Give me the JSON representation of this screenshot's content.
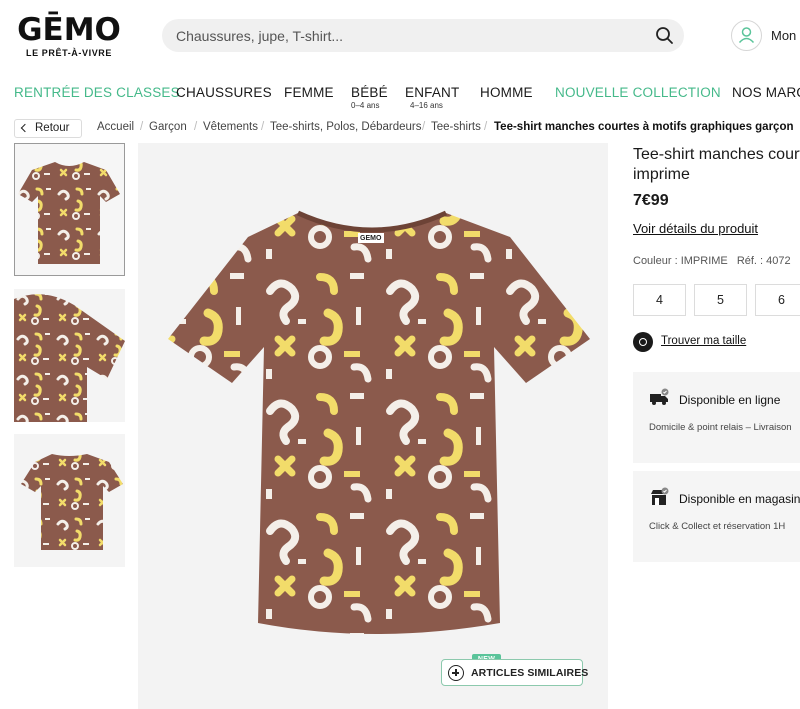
{
  "header": {
    "logo_word": "GĒMO",
    "logo_tagline": "LE PRÊT-À-VIVRE",
    "search_placeholder": "Chaussures, jupe, T-shirt...",
    "account_label": "Mon"
  },
  "nav": {
    "items": [
      {
        "label": "RENTRÉE DES CLASSES",
        "sub": ""
      },
      {
        "label": "CHAUSSURES",
        "sub": ""
      },
      {
        "label": "FEMME",
        "sub": ""
      },
      {
        "label": "BÉBÉ",
        "sub": "0–4 ans"
      },
      {
        "label": "ENFANT",
        "sub": "4–16 ans"
      },
      {
        "label": "HOMME",
        "sub": ""
      },
      {
        "label": "NOUVELLE COLLECTION",
        "sub": ""
      },
      {
        "label": "NOS MARQ",
        "sub": ""
      }
    ]
  },
  "breadcrumb": {
    "back_label": "Retour",
    "items": [
      "Accueil",
      "Garçon",
      "Vêtements",
      "Tee-shirts, Polos, Débardeurs",
      "Tee-shirts"
    ],
    "current": "Tee-shirt manches courtes à motifs graphiques garçon"
  },
  "main_image": {
    "neck_label": "GEMO",
    "new_badge": "NEW",
    "similar_label": "ARTICLES SIMILAIRES"
  },
  "product": {
    "title": "Tee-shirt manches courtes imprime",
    "price": "7€99",
    "details_link": "Voir détails du produit",
    "color_label": "Couleur : IMPRIME",
    "ref_label": "Réf. : 4072",
    "sizes": [
      "4",
      "5",
      "6"
    ],
    "find_size_label": "Trouver ma taille"
  },
  "availability": [
    {
      "title": "Disponible en ligne",
      "subtitle": "Domicile & point relais – Livraison",
      "icon": "delivery-truck-icon"
    },
    {
      "title": "Disponible en magasin",
      "subtitle": "Click & Collect et réservation 1H",
      "icon": "store-icon"
    }
  ],
  "colors": {
    "accent_green": "#45b98a",
    "shirt_brown": "#8b5a4c",
    "print_yellow": "#f2dc6a",
    "print_white": "#f4efe9"
  }
}
